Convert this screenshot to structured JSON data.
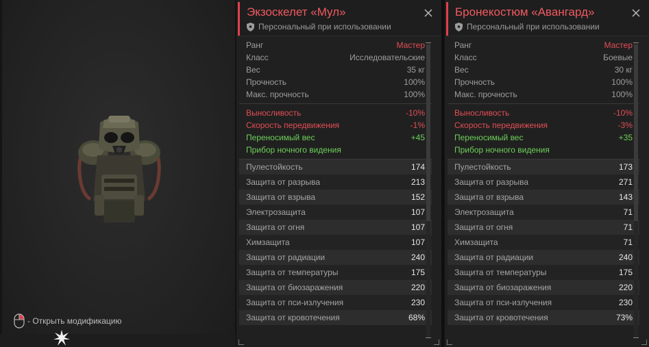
{
  "preview": {
    "hint_text": "- Открыть модификацию",
    "mouse_icon": "mouse-right-click-icon",
    "burst_icon": "burst-icon"
  },
  "colors": {
    "accent": "#e0404c",
    "negative": "#e24e56",
    "positive": "#6ed05a",
    "rank": "#e24e56"
  },
  "cards": [
    {
      "title": "Экзоскелет «Мул»",
      "subtitle": "Персональный при использовании",
      "info": [
        {
          "label": "Ранг",
          "value": "Мастер",
          "highlight": true
        },
        {
          "label": "Класс",
          "value": "Исследовательские"
        },
        {
          "label": "Вес",
          "value": "35 кг"
        },
        {
          "label": "Прочность",
          "value": "100%"
        },
        {
          "label": "Макс. прочность",
          "value": "100%"
        }
      ],
      "effects": [
        {
          "label": "Выносливость",
          "value": "-10%",
          "tone": "red"
        },
        {
          "label": "Скорость передвижения",
          "value": "-1%",
          "tone": "red"
        },
        {
          "label": "Переносимый вес",
          "value": "+45",
          "tone": "green"
        },
        {
          "label": "Прибор ночного видения",
          "value": "",
          "tone": "green"
        }
      ],
      "stats": [
        {
          "label": "Пулестойкость",
          "value": "174"
        },
        {
          "label": "Защита от разрыва",
          "value": "213"
        },
        {
          "label": "Защита от взрыва",
          "value": "152"
        },
        {
          "label": "Электрозащита",
          "value": "107"
        },
        {
          "label": "Защита от огня",
          "value": "107"
        },
        {
          "label": "Химзащита",
          "value": "107"
        },
        {
          "label": "Защита от радиации",
          "value": "240"
        },
        {
          "label": "Защита от температуры",
          "value": "175"
        },
        {
          "label": "Защита от биозаражения",
          "value": "220"
        },
        {
          "label": "Защита от пси-излучения",
          "value": "230"
        },
        {
          "label": "Защита от кровотечения",
          "value": "68%"
        }
      ]
    },
    {
      "title": "Бронекостюм «Авангард»",
      "subtitle": "Персональный при использовании",
      "info": [
        {
          "label": "Ранг",
          "value": "Мастер",
          "highlight": true
        },
        {
          "label": "Класс",
          "value": "Боевые"
        },
        {
          "label": "Вес",
          "value": "30 кг"
        },
        {
          "label": "Прочность",
          "value": "100%"
        },
        {
          "label": "Макс. прочность",
          "value": "100%"
        }
      ],
      "effects": [
        {
          "label": "Выносливость",
          "value": "-10%",
          "tone": "red"
        },
        {
          "label": "Скорость передвижения",
          "value": "-3%",
          "tone": "red"
        },
        {
          "label": "Переносимый вес",
          "value": "+35",
          "tone": "green"
        },
        {
          "label": "Прибор ночного видения",
          "value": "",
          "tone": "green"
        }
      ],
      "stats": [
        {
          "label": "Пулестойкость",
          "value": "173"
        },
        {
          "label": "Защита от разрыва",
          "value": "271"
        },
        {
          "label": "Защита от взрыва",
          "value": "143"
        },
        {
          "label": "Электрозащита",
          "value": "71"
        },
        {
          "label": "Защита от огня",
          "value": "71"
        },
        {
          "label": "Химзащита",
          "value": "71"
        },
        {
          "label": "Защита от радиации",
          "value": "240"
        },
        {
          "label": "Защита от температуры",
          "value": "175"
        },
        {
          "label": "Защита от биозаражения",
          "value": "220"
        },
        {
          "label": "Защита от пси-излучения",
          "value": "230"
        },
        {
          "label": "Защита от кровотечения",
          "value": "73%"
        }
      ]
    }
  ]
}
